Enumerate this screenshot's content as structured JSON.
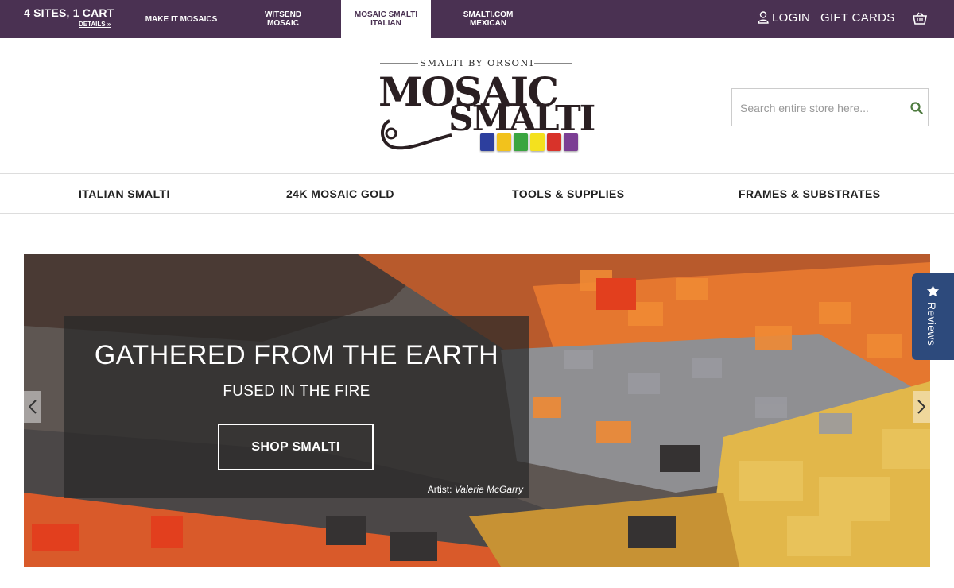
{
  "topbar": {
    "promo_title": "4 SITES, 1 CART",
    "promo_details": "DETAILS »",
    "sites": [
      {
        "label": "MAKE IT MOSAICS",
        "active": false
      },
      {
        "label": "WITSEND\nMOSAIC",
        "active": false
      },
      {
        "label": "MOSAIC SMALTI\nITALIAN",
        "active": true
      },
      {
        "label": "SMALTI.COM\nMEXICAN",
        "active": false
      }
    ],
    "login_label": "LOGIN",
    "gift_cards_label": "GIFT CARDS",
    "icons": {
      "user": "user-icon",
      "cart": "basket-icon"
    },
    "bg_color": "#4a3152"
  },
  "brand": {
    "subtitle": "SMALTI BY ORSONI",
    "word1": "MOSAIC",
    "word2": "SMALTI",
    "tile_colors": [
      "#2d3f9e",
      "#f2c21c",
      "#3aa540",
      "#f4e11e",
      "#d8332a",
      "#7b3e93"
    ]
  },
  "search": {
    "placeholder": "Search entire store here...",
    "value": "",
    "icon": "search-icon",
    "icon_color": "#4d7a3e"
  },
  "nav": {
    "items": [
      "ITALIAN SMALTI",
      "24K MOSAIC GOLD",
      "TOOLS & SUPPLIES",
      "FRAMES & SUBSTRATES"
    ]
  },
  "hero": {
    "title": "GATHERED FROM THE EARTH",
    "subtitle": "FUSED IN THE FIRE",
    "button_label": "SHOP SMALTI",
    "credit_prefix": "Artist:",
    "credit_name": "Valerie McGarry",
    "prev_icon": "chevron-left-icon",
    "next_icon": "chevron-right-icon"
  },
  "reviews_tab": {
    "label": "Reviews",
    "icon": "star-icon",
    "color": "#2d4a7c"
  }
}
